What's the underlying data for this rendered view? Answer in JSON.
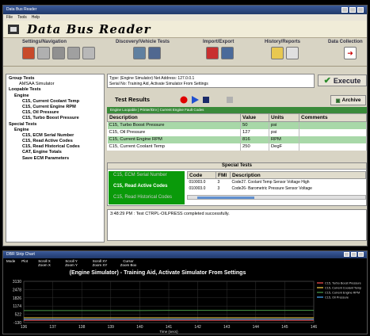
{
  "window": {
    "title": "Data Bus Reader"
  },
  "menu": [
    "File",
    "Tools",
    "Help"
  ],
  "brand": "Data Bus Reader",
  "toolbar_groups": [
    {
      "label": "Settings/Navigation",
      "icons": [
        "toolbox-icon",
        "wrench-icon",
        "gear-icon",
        "car-icon",
        "grid-icon"
      ]
    },
    {
      "label": "Discovery/Vehicle Tests",
      "icons": [
        "car-icon",
        "truck-icon"
      ]
    },
    {
      "label": "Import/Export",
      "icons": [
        "import-icon",
        "export-icon"
      ]
    },
    {
      "label": "History/Reports",
      "icons": [
        "folder-icon",
        "report-icon"
      ]
    },
    {
      "label": "Data Collection",
      "icons": [
        "exit-icon"
      ]
    }
  ],
  "tree": [
    {
      "label": "Group Tests",
      "indent": 0
    },
    {
      "label": "AMSAA Simulator",
      "indent": 1
    },
    {
      "label": "Loopable Tests",
      "indent": 0
    },
    {
      "label": "Engine",
      "indent": 1
    },
    {
      "label": "C15, Current Coolant Temp",
      "indent": 2
    },
    {
      "label": "C15, Current Engine RPM",
      "indent": 2
    },
    {
      "label": "C15, Oil Pressure",
      "indent": 2
    },
    {
      "label": "C15, Turbo Boost Pressure",
      "indent": 2
    },
    {
      "label": "Special Tests",
      "indent": 0
    },
    {
      "label": "Engine",
      "indent": 1
    },
    {
      "label": "C15, ECM Serial Number",
      "indent": 2
    },
    {
      "label": "C15, Read Active Codes",
      "indent": 2
    },
    {
      "label": "C15, Read Historical Codes",
      "indent": 2
    },
    {
      "label": "CAT, Engine Totals",
      "indent": 2
    },
    {
      "label": "Save ECM Parameters",
      "indent": 2
    }
  ],
  "info": {
    "line1": "Type: (Engine Simulator)  Net Address: 127.0.0.1",
    "line2": "Serial No: Training Aid, Activate Simulator From Settings"
  },
  "execute_label": "Execute",
  "archive_label": "Archive",
  "test_results_label": "Test Results",
  "status_tabs_text": "Engine Loopable | Printer/Drv | Current Engine Fault Codes",
  "results": {
    "headers": [
      "Description",
      "Value",
      "Units",
      "Comments"
    ],
    "rows": [
      {
        "description": "C15, Turbo Boost Pressure",
        "value": "50",
        "units": "psi",
        "comments": ""
      },
      {
        "description": "C15, Oil Pressure",
        "value": "127",
        "units": "psi",
        "comments": ""
      },
      {
        "description": "C15, Current Engine RPM",
        "value": "816",
        "units": "RPM",
        "comments": ""
      },
      {
        "description": "C15, Current Coolant Temp",
        "value": "250",
        "units": "DegF",
        "comments": ""
      }
    ],
    "selected_rows": [
      0,
      2
    ]
  },
  "special_tests": {
    "title": "Special Tests",
    "items": [
      "C15, ECM Serial Number",
      "C15, Read Active Codes",
      "C15, Read Historical Codes"
    ],
    "code_headers": [
      "Code",
      "FMI",
      "Description"
    ],
    "codes": [
      {
        "code": "010003.0",
        "fmi": "3",
        "description": "Code27. Coolant Temp Sensor Voltage High"
      },
      {
        "code": "010003.0",
        "fmi": "3",
        "description": "Code26- Barometric Pressure Sensor Voltage"
      }
    ]
  },
  "log": "3:48:29 PM : Test CTRPL-OILPRESS completed successfully.",
  "chart_window": {
    "title": "DBR Strip Chart",
    "toolbar": [
      "Mode",
      "Plot",
      "Scroll X Zoom X",
      "Scroll Y Zoom Y",
      "Scroll XY Zoom XY",
      "Cursor Zoom Box"
    ]
  },
  "chart_data": {
    "type": "line",
    "title": "(Engine Simulator) - Training Aid, Activate Simulator From Settings",
    "xlabel": "Time (secs)",
    "x": [
      136,
      137,
      138,
      139,
      140,
      141,
      142,
      143,
      144,
      145,
      146
    ],
    "ytick_labels": [
      "3130",
      "2478",
      "1826",
      "1174",
      "522",
      "-130"
    ],
    "xlim": [
      136,
      146
    ],
    "ylim": [
      -130,
      3130
    ],
    "series": [
      {
        "name": "C15, Turbo Boost Pressure",
        "color": "#ff5050",
        "values": [
          50,
          50,
          50,
          50,
          50,
          50,
          50,
          50,
          50,
          50,
          50
        ]
      },
      {
        "name": "C15, Current Coolant Temp",
        "color": "#ffd24a",
        "values": [
          250,
          250,
          250,
          250,
          250,
          250,
          250,
          250,
          250,
          250,
          250
        ]
      },
      {
        "name": "C15, Current Engine RPM",
        "color": "#4a9a4a",
        "values": [
          816,
          816,
          816,
          816,
          816,
          830,
          830,
          830,
          830,
          830,
          830
        ]
      },
      {
        "name": "C15, Oil Pressure",
        "color": "#4ab0ff",
        "values": [
          127,
          127,
          127,
          127,
          127,
          127,
          127,
          127,
          127,
          127,
          127
        ]
      }
    ]
  }
}
